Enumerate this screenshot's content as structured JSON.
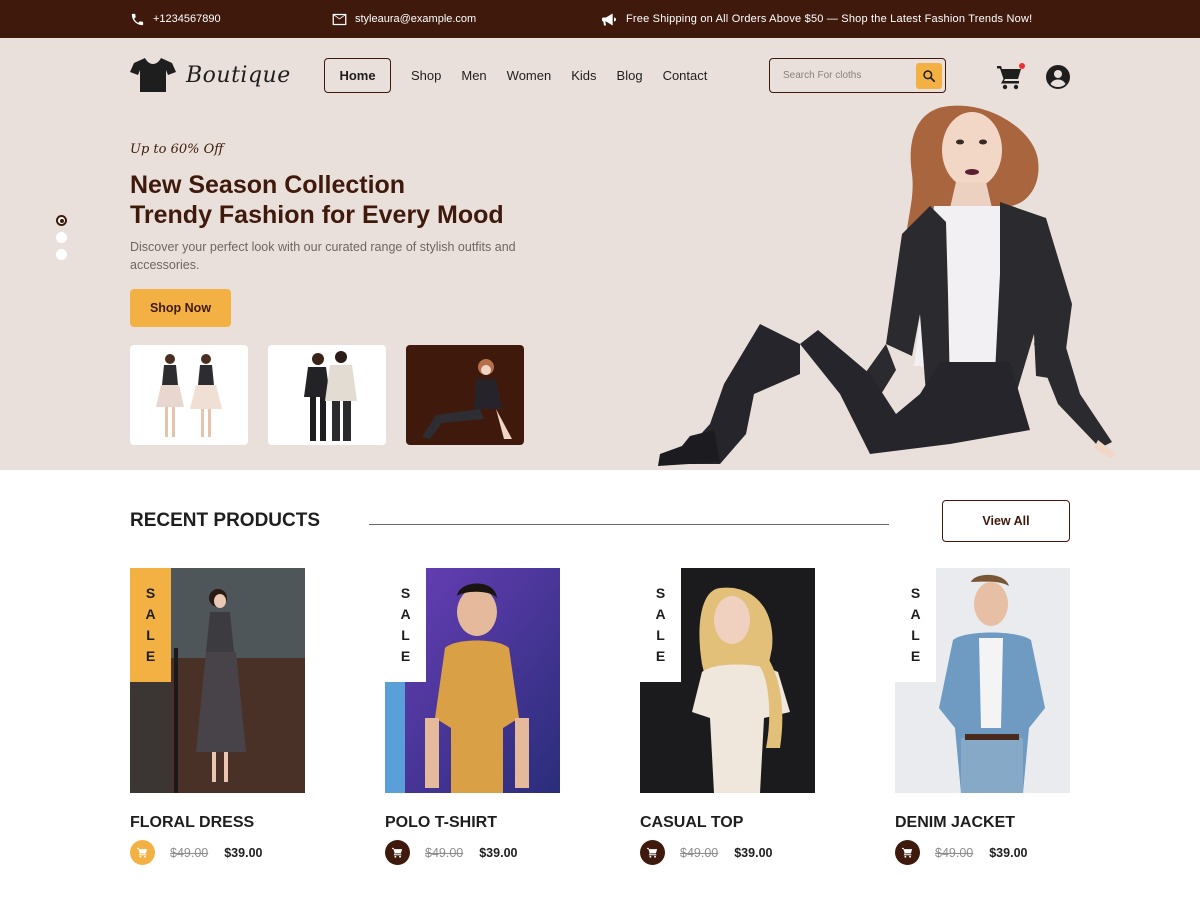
{
  "topbar": {
    "phone": "+1234567890",
    "email": "styleaura@example.com",
    "announcement": "Free Shipping on All Orders Above $50 — Shop the Latest Fashion Trends Now!"
  },
  "header": {
    "logo_text": "Boutique",
    "search_placeholder": "Search For cloths",
    "nav": [
      {
        "label": "Home",
        "active": true
      },
      {
        "label": "Shop"
      },
      {
        "label": "Men"
      },
      {
        "label": "Women"
      },
      {
        "label": "Kids"
      },
      {
        "label": "Blog"
      },
      {
        "label": "Contact"
      }
    ],
    "icons": [
      "tshirt-icon",
      "search-icon",
      "cart-icon",
      "user-icon"
    ]
  },
  "hero": {
    "tagline": "Up to 60% Off",
    "headline_line1": "New Season Collection",
    "headline_line2": "Trendy Fashion for Every Mood",
    "description": "Discover your perfect look with our curated range of stylish outfits and accessories.",
    "cta_label": "Shop Now",
    "slide_count": 3,
    "active_slide": 1
  },
  "recent_products": {
    "title": "RECENT PRODUCTS",
    "view_all_label": "View All",
    "sale_letters": [
      "S",
      "A",
      "L",
      "E"
    ],
    "items": [
      {
        "name": "FLORAL DRESS",
        "old_price": "$49.00",
        "price": "$39.00"
      },
      {
        "name": "POLO T-SHIRT",
        "old_price": "$49.00",
        "price": "$39.00"
      },
      {
        "name": "CASUAL TOP",
        "old_price": "$49.00",
        "price": "$39.00"
      },
      {
        "name": "DENIM JACKET",
        "old_price": "$49.00",
        "price": "$39.00"
      }
    ]
  },
  "colors": {
    "brand_brown": "#3f1a0c",
    "accent_yellow": "#f3b144",
    "hero_bg": "#eae0db"
  }
}
